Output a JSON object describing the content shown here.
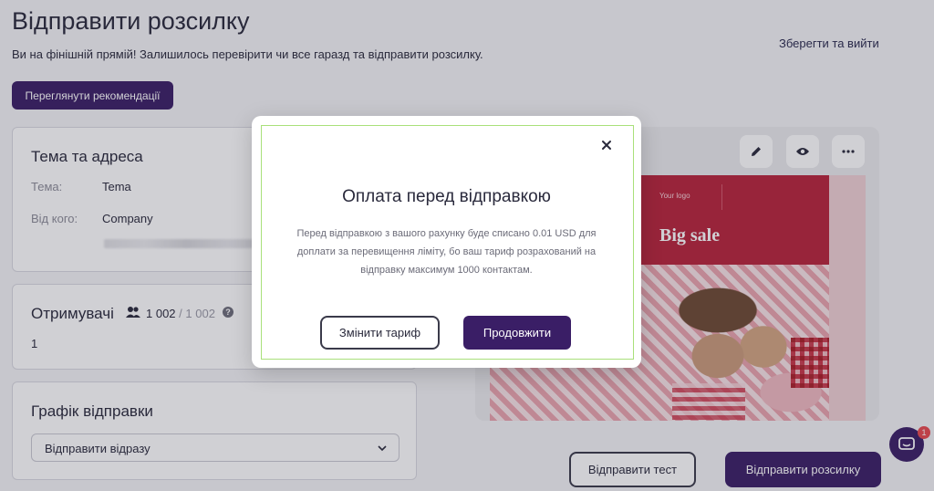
{
  "page": {
    "title": "Відправити розсилку",
    "subtitle": "Ви на фінішній прямій! Залишилось перевірити чи все гаразд та відправити розсилку.",
    "save_exit_label": "Зберегти та вийти",
    "recommendations_label": "Переглянути рекомендації"
  },
  "subject_card": {
    "title": "Тема та адреса",
    "subject_label": "Тема:",
    "subject_value": "Tema",
    "from_label": "Від кого:",
    "from_value": "Company"
  },
  "recipients_card": {
    "title": "Отримувачі",
    "count": "1 002",
    "total": "/ 1 002",
    "list_value": "1"
  },
  "schedule_card": {
    "title": "Графік відправки",
    "select_value": "Відправити відразу"
  },
  "preview": {
    "tools": [
      "pencil-icon",
      "eye-icon",
      "more-icon"
    ],
    "logo_text": "Your logo",
    "headline": "Big sale"
  },
  "footer": {
    "send_test_label": "Відправити тест",
    "send_label": "Відправити розсилку"
  },
  "chat": {
    "badge_count": "1"
  },
  "modal": {
    "title": "Оплата перед відправкою",
    "body": "Перед відправкою з вашого рахунку буде списано 0.01 USD для доплати за перевищення ліміту, бо ваш тариф розрахований на відправку максимум 1000 контактам.",
    "change_plan_label": "Змінити тариф",
    "continue_label": "Продовжити"
  },
  "colors": {
    "brand": "#3a1e66",
    "email_header": "#b8233a",
    "chat_badge": "#e8484d"
  }
}
